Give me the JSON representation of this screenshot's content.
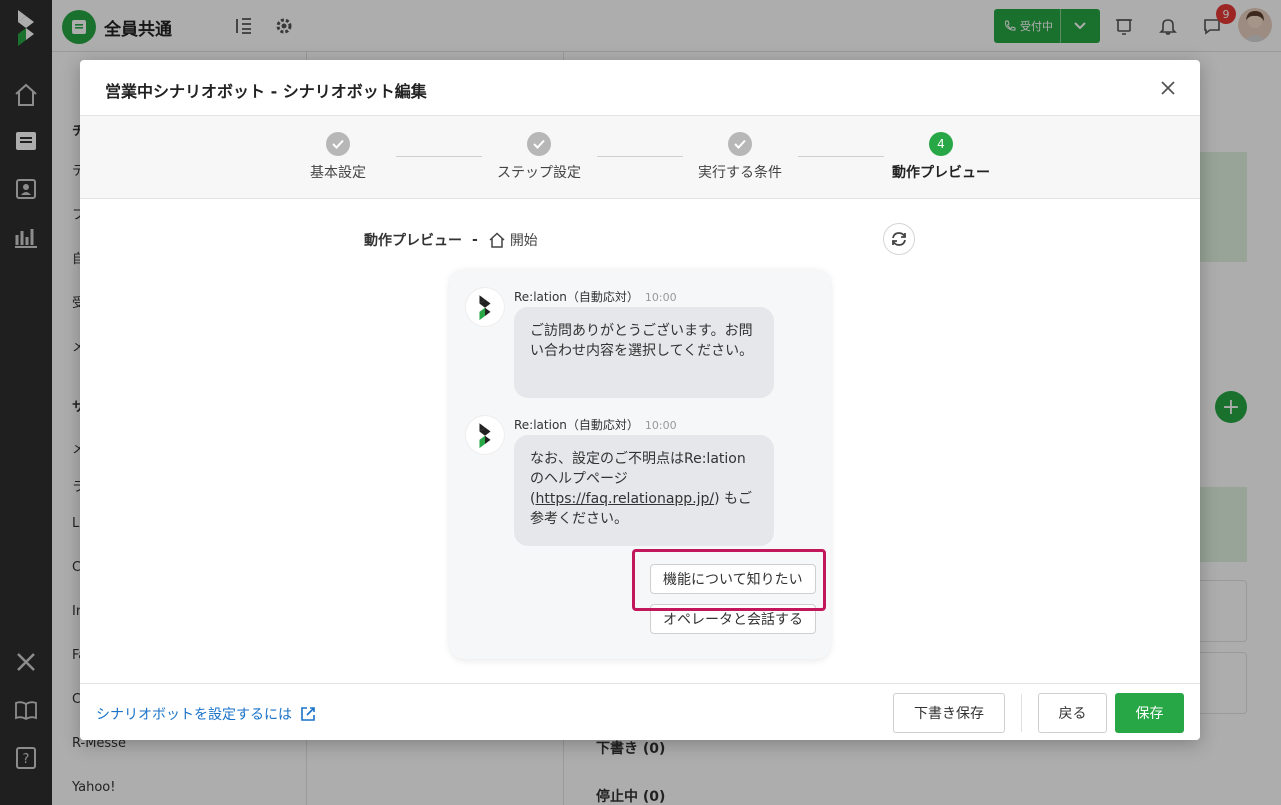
{
  "app": {
    "inbox_title": "全員共通",
    "status_label": "受付中",
    "notification_count": "9",
    "colors": {
      "brand_green": "#27a745",
      "highlight": "#c2185b",
      "nav_bg": "#2f2f2f"
    }
  },
  "sidebar": {
    "items": [
      "チ",
      "テ",
      "フ",
      "自",
      "受",
      "メ",
      "サ",
      "メ",
      "ラ",
      "L",
      "C",
      "In",
      "Fa",
      "C",
      "R-Messe",
      "Yahoo!"
    ]
  },
  "main": {
    "drafts_label": "下書き (0)",
    "stopped_label": "停止中 (0)"
  },
  "modal": {
    "title": "営業中シナリオボット - シナリオボット編集",
    "steps": [
      {
        "number": "1",
        "label": "基本設定",
        "state": "done"
      },
      {
        "number": "2",
        "label": "ステップ設定",
        "state": "done"
      },
      {
        "number": "3",
        "label": "実行する条件",
        "state": "done"
      },
      {
        "number": "4",
        "label": "動作プレビュー",
        "state": "active"
      }
    ],
    "preview": {
      "title": "動作プレビュー",
      "separator": "-",
      "start_label": "開始"
    },
    "chat": {
      "messages": [
        {
          "sender": "Re:lation（自動応対）",
          "time": "10:00",
          "text": "ご訪問ありがとうございます。お問い合わせ内容を選択してください。"
        },
        {
          "sender": "Re:lation（自動応対）",
          "time": "10:00",
          "text_before": "なお、設定のご不明点はRe:lationのヘルプページ (",
          "link": "https://faq.relationapp.jp/",
          "text_after": ") もご参考ください。"
        }
      ],
      "choices": [
        "機能について知りたい",
        "オペレータと会話する"
      ]
    },
    "footer": {
      "help_link": "シナリオボットを設定するには",
      "draft_save": "下書き保存",
      "back": "戻る",
      "save": "保存"
    }
  }
}
